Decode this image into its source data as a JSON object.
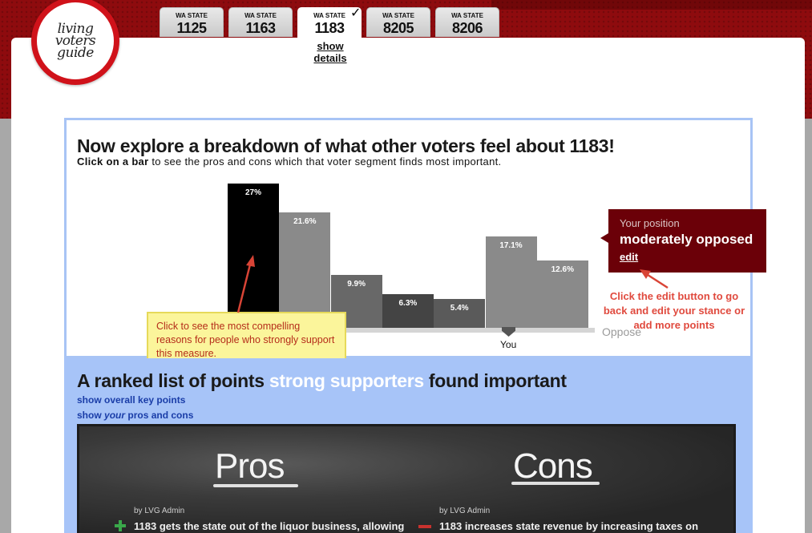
{
  "logo": {
    "lines": [
      "living",
      "voters",
      "guide"
    ]
  },
  "tabs": [
    {
      "state": "WA STATE",
      "number": "1125"
    },
    {
      "state": "WA STATE",
      "number": "1163"
    },
    {
      "state": "WA STATE",
      "number": "1183"
    },
    {
      "state": "WA STATE",
      "number": "8205"
    },
    {
      "state": "WA STATE",
      "number": "8206"
    }
  ],
  "active_tab": {
    "checkmark": "✓",
    "show_details": [
      "show",
      "details"
    ]
  },
  "breakdown": {
    "title": "Now explore a breakdown of what other voters feel about 1183!",
    "instruction_bold": "Click on a bar",
    "instruction_rest": " to see the pros and cons which that voter segment finds most important."
  },
  "chart_data": {
    "type": "bar",
    "values": [
      27,
      21.6,
      9.9,
      6.3,
      5.4,
      17.1,
      12.6
    ],
    "labels": [
      "27%",
      "21.6%",
      "9.9%",
      "6.3%",
      "5.4%",
      "17.1%",
      "12.6%"
    ],
    "colors": [
      "#000000",
      "#8a8a8a",
      "#686868",
      "#444444",
      "#5a5a5a",
      "#8a8a8a",
      "#8a8a8a"
    ],
    "axis_right_label": "Oppose",
    "you_label": "You"
  },
  "tooltip": {
    "text": "Click to see the most compelling reasons for people who strongly support this measure."
  },
  "position": {
    "title": "Your position",
    "value": "moderately opposed",
    "edit": "edit"
  },
  "edit_note": "Click the edit button to go back and edit your stance or add more points",
  "ranked": {
    "heading_pre": "A ranked list of points ",
    "heading_highlight": "strong supporters",
    "heading_post": " found important",
    "link_overall": "show overall key points",
    "link_yours_pre": "show ",
    "link_yours_em": "your",
    "link_yours_post": " pros and cons"
  },
  "board": {
    "pros_title": "Pros",
    "cons_title": "Cons",
    "pro_byline": "by LVG Admin",
    "con_byline": "by LVG Admin",
    "pro_point": "1183 gets the state out of the liquor business, allowing",
    "con_point": "1183 increases state revenue by increasing taxes on"
  }
}
